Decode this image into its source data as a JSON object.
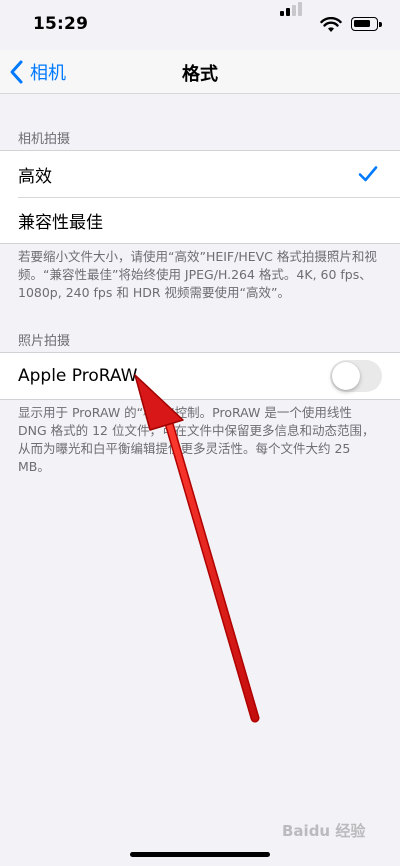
{
  "status_bar": {
    "time": "15:29",
    "icons": [
      "signal-icon",
      "wifi-icon",
      "battery-icon"
    ]
  },
  "nav": {
    "back_label": "相机",
    "title": "格式",
    "accent_color": "#007aff"
  },
  "camera_capture": {
    "header": "相机拍摄",
    "options": [
      {
        "label": "高效",
        "selected": true
      },
      {
        "label": "兼容性最佳",
        "selected": false
      }
    ],
    "footer": "若要缩小文件大小，请使用“高效”HEIF/HEVC 格式拍摄照片和视频。“兼容性最佳”将始终使用 JPEG/H.264 格式。4K, 60 fps、1080p, 240 fps 和 HDR 视频需要使用“高效”。"
  },
  "photo_capture": {
    "header": "照片拍摄",
    "proraw_label": "Apple ProRAW",
    "proraw_enabled": false,
    "footer": "显示用于 ProRAW 的“相机”控制。ProRAW 是一个使用线性 DNG 格式的 12 位文件，可在文件中保留更多信息和动态范围，从而为曝光和白平衡编辑提供更多灵活性。每个文件大约 25 MB。"
  },
  "annotation": {
    "arrow_color": "#e01b1b"
  },
  "watermark": "Baidu 经验"
}
